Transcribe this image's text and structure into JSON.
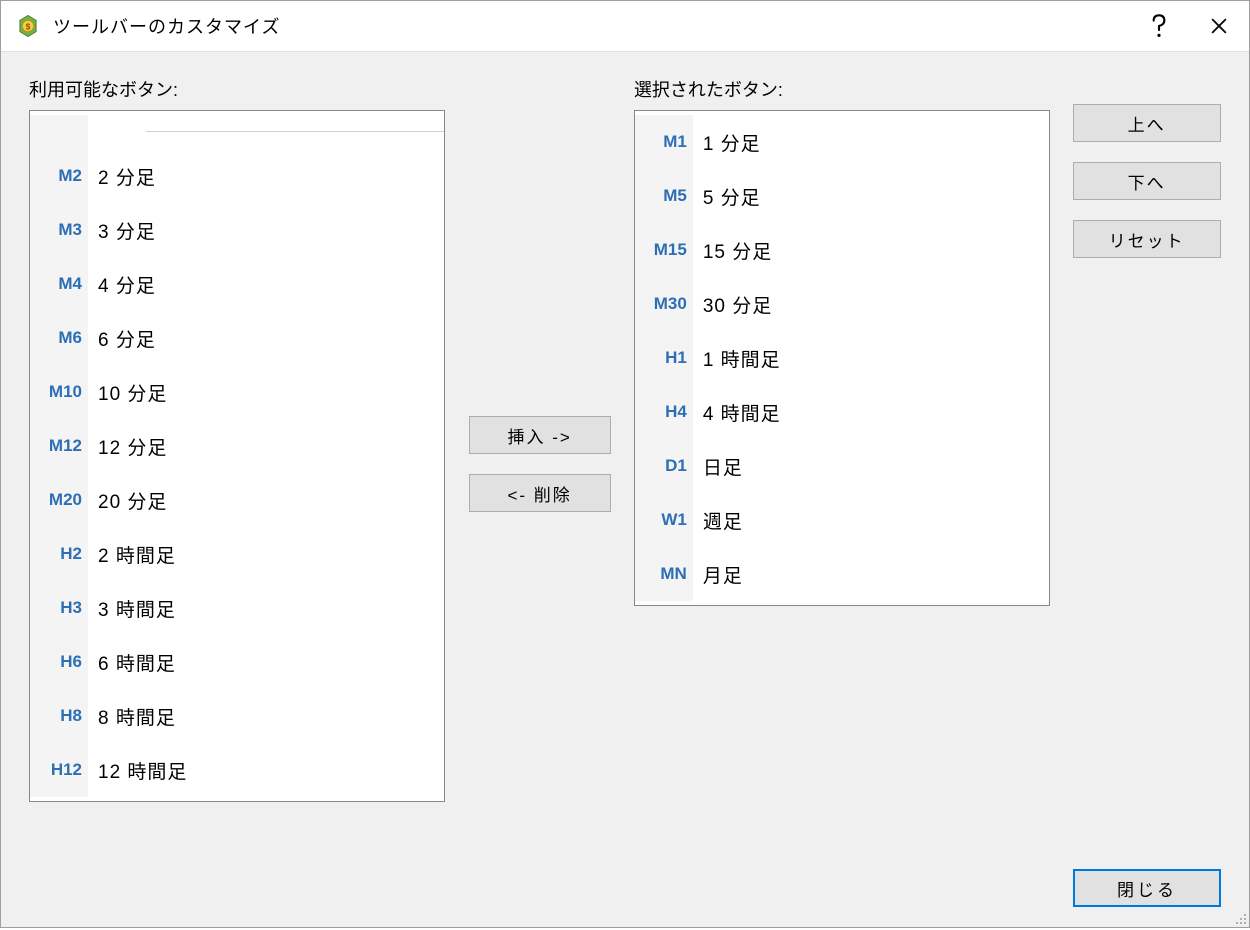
{
  "window": {
    "title": "ツールバーのカスタマイズ"
  },
  "labels": {
    "available": "利用可能なボタン:",
    "selected": "選択されたボタン:"
  },
  "buttons": {
    "insert": "挿入 ->",
    "remove": "<- 削除",
    "up": "上へ",
    "down": "下へ",
    "reset": "リセット",
    "close": "閉じる"
  },
  "available_items": [
    {
      "code": "M2",
      "label": "2 分足"
    },
    {
      "code": "M3",
      "label": "3 分足"
    },
    {
      "code": "M4",
      "label": "4 分足"
    },
    {
      "code": "M6",
      "label": "6 分足"
    },
    {
      "code": "M10",
      "label": "10 分足"
    },
    {
      "code": "M12",
      "label": "12 分足"
    },
    {
      "code": "M20",
      "label": "20 分足"
    },
    {
      "code": "H2",
      "label": "2 時間足"
    },
    {
      "code": "H3",
      "label": "3 時間足"
    },
    {
      "code": "H6",
      "label": "6 時間足"
    },
    {
      "code": "H8",
      "label": "8 時間足"
    },
    {
      "code": "H12",
      "label": "12 時間足"
    }
  ],
  "selected_items": [
    {
      "code": "M1",
      "label": "1 分足"
    },
    {
      "code": "M5",
      "label": "5 分足"
    },
    {
      "code": "M15",
      "label": "15 分足"
    },
    {
      "code": "M30",
      "label": "30 分足"
    },
    {
      "code": "H1",
      "label": "1 時間足"
    },
    {
      "code": "H4",
      "label": "4 時間足"
    },
    {
      "code": "D1",
      "label": "日足"
    },
    {
      "code": "W1",
      "label": "週足"
    },
    {
      "code": "MN",
      "label": "月足"
    }
  ]
}
